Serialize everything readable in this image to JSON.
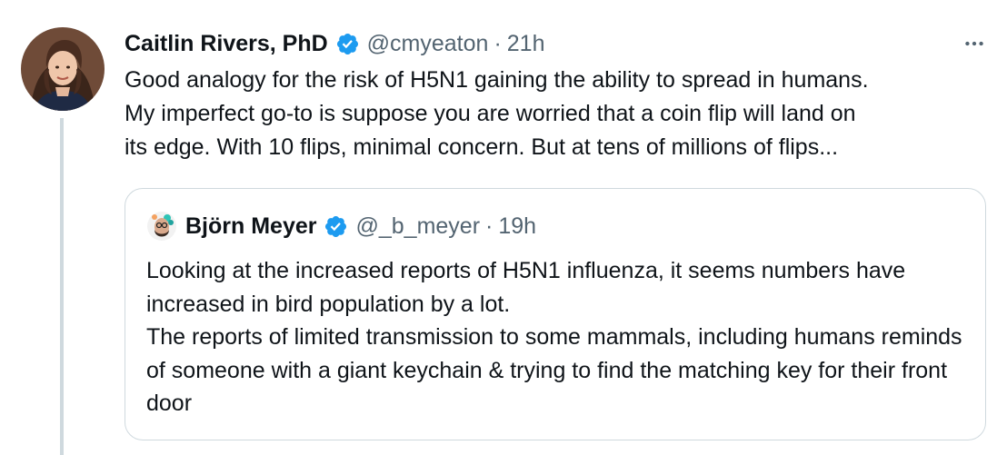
{
  "tweet": {
    "author": {
      "display_name": "Caitlin Rivers, PhD",
      "handle": "@cmyeaton",
      "separator": "·",
      "time": "21h",
      "verified": true
    },
    "more_label": "More",
    "text": "Good analogy for the risk of H5N1 gaining the ability to spread in humans.\nMy imperfect go-to is suppose you are worried that a coin flip will land on\nits edge. With 10 flips, minimal concern. But at tens of millions of flips..."
  },
  "quoted_tweet": {
    "author": {
      "display_name": "Björn Meyer",
      "handle": "@_b_meyer",
      "separator": "·",
      "time": "19h",
      "verified": true
    },
    "paragraphs": [
      "Looking at the increased reports of H5N1 influenza, it seems numbers have increased in bird population by a lot.",
      "The reports of limited transmission to some mammals, including humans reminds of someone with a giant keychain & trying to find the matching key for their front door"
    ]
  },
  "colors": {
    "verified_blue": "#1d9bf0",
    "secondary_text": "#536471",
    "primary_text": "#0f1419",
    "border": "#cfd9de"
  }
}
